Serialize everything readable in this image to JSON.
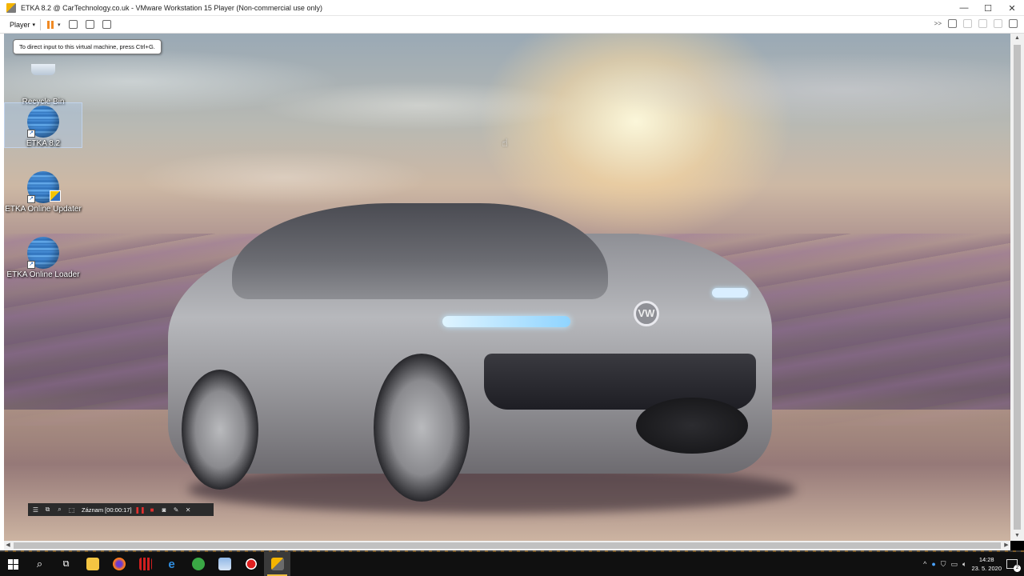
{
  "window": {
    "title": "ETKA 8.2 @ CarTechnology.co.uk - VMware Workstation 15 Player (Non-commercial use only)",
    "controls": {
      "minimize": "—",
      "maximize": "☐",
      "close": "✕"
    }
  },
  "toolbar": {
    "player_label": "Player",
    "player_caret": "▾",
    "pause_caret": "▾",
    "right_icons": [
      ">>"
    ]
  },
  "tooltip": {
    "text": "To direct input to this virtual machine, press Ctrl+G."
  },
  "desktop": {
    "icons": [
      {
        "label": "Recycle Bin"
      },
      {
        "label": "ETKA 8.2"
      },
      {
        "label": "ETKA Online Updater"
      },
      {
        "label": "ETKA Online Loader"
      }
    ],
    "car_logo": "VW"
  },
  "recorder": {
    "label": "Záznam [00:00:17]"
  },
  "taskbar": {
    "clock_time": "14:28",
    "clock_date": "23. 5. 2020",
    "notification_count": "2",
    "tray_chevron": "^"
  },
  "colors": {
    "pause_accent": "#f08a24",
    "taskbar_bg": "#101010",
    "active_underline": "#f0c040"
  }
}
